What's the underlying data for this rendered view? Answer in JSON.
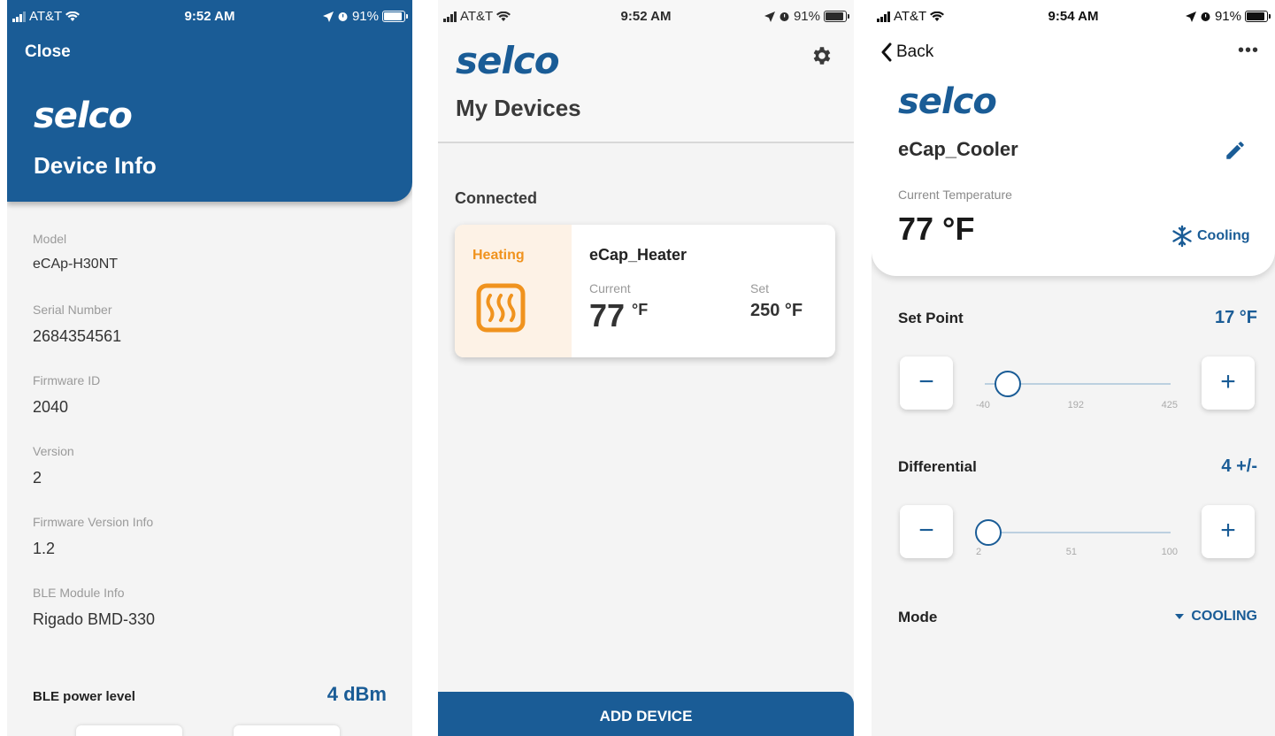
{
  "colors": {
    "brand_blue": "#1a5c96",
    "heating_orange": "#f0931e",
    "heating_bg": "#fdf2e6",
    "cooling_blue": "#1a5c96"
  },
  "screen_device_info": {
    "status": {
      "carrier": "AT&T",
      "time": "9:52 AM",
      "battery": "91%"
    },
    "close_label": "Close",
    "logo_text": "selco",
    "title": "Device Info",
    "fields": [
      {
        "label": "Model",
        "value": "eCAp-H30NT"
      },
      {
        "label": "Serial Number",
        "value": "2684354561"
      },
      {
        "label": "Firmware ID",
        "value": "2040"
      },
      {
        "label": "Version",
        "value": "2"
      },
      {
        "label": "Firmware Version Info",
        "value": "1.2"
      },
      {
        "label": "BLE Module Info",
        "value": "Rigado BMD-330"
      }
    ],
    "ble_power": {
      "label": "BLE power level",
      "value": "4 dBm"
    }
  },
  "screen_my_devices": {
    "status": {
      "carrier": "AT&T",
      "time": "9:52 AM",
      "battery": "91%"
    },
    "logo_text": "selco",
    "settings_icon": "gear-icon",
    "title": "My Devices",
    "section_label": "Connected",
    "device_card": {
      "state": "Heating",
      "state_icon": "heating-element-icon",
      "name": "eCap_Heater",
      "current_label": "Current",
      "current_value": "77",
      "current_unit": "°F",
      "set_label": "Set",
      "set_value": "250 °F"
    },
    "add_device_label": "ADD DEVICE"
  },
  "screen_device_detail": {
    "status": {
      "carrier": "AT&T",
      "time": "9:54 AM",
      "battery": "91%"
    },
    "back_label": "Back",
    "more_label": "•••",
    "logo_text": "selco",
    "device_name": "eCap_Cooler",
    "current_temp_label": "Current Temperature",
    "current_temp_value": "77 °F",
    "cooling_status": "Cooling",
    "set_point": {
      "label": "Set Point",
      "value_display": "17 °F",
      "minus": "−",
      "plus": "+",
      "min_label": "-40",
      "mid_label": "192",
      "max_label": "425",
      "min": -40,
      "max": 425,
      "value": 17
    },
    "differential": {
      "label": "Differential",
      "value_display": "4 +/-",
      "minus": "−",
      "plus": "+",
      "min_label": "2",
      "mid_label": "51",
      "max_label": "100",
      "min": 2,
      "max": 100,
      "value": 4
    },
    "mode": {
      "label": "Mode",
      "value": "COOLING"
    }
  }
}
